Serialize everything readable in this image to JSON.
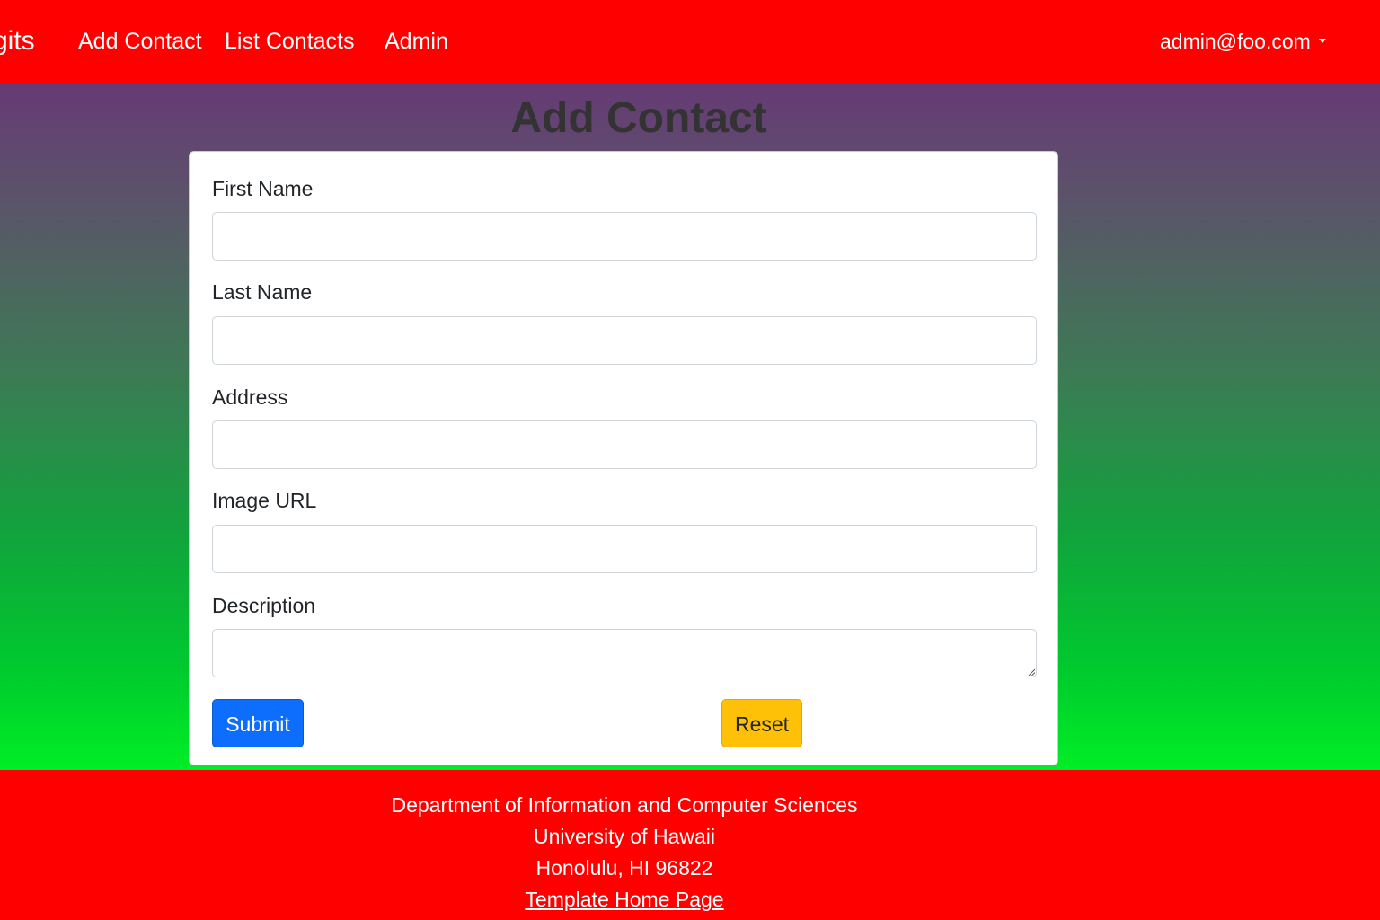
{
  "navbar": {
    "brand": "gits",
    "links": [
      {
        "label": "Add Contact"
      },
      {
        "label": "List Contacts"
      },
      {
        "label": "Admin"
      }
    ],
    "user": "admin@foo.com",
    "background": "#ff0000"
  },
  "page": {
    "title": "Add Contact"
  },
  "form": {
    "fields": [
      {
        "label": "First Name",
        "value": "",
        "placeholder": ""
      },
      {
        "label": "Last Name",
        "value": "",
        "placeholder": ""
      },
      {
        "label": "Address",
        "value": "",
        "placeholder": ""
      },
      {
        "label": "Image URL",
        "value": "",
        "placeholder": ""
      },
      {
        "label": "Description",
        "value": "",
        "placeholder": ""
      }
    ],
    "submit_label": "Submit",
    "reset_label": "Reset",
    "submit_color": "#0d6efd",
    "reset_color": "#ffc107"
  },
  "footer": {
    "line1": "Department of Information and Computer Sciences",
    "line2": "University of Hawaii",
    "line3": "Honolulu, HI 96822",
    "link": "Template Home Page"
  },
  "icons": {
    "user_menu_caret": "chevron-down-icon"
  }
}
